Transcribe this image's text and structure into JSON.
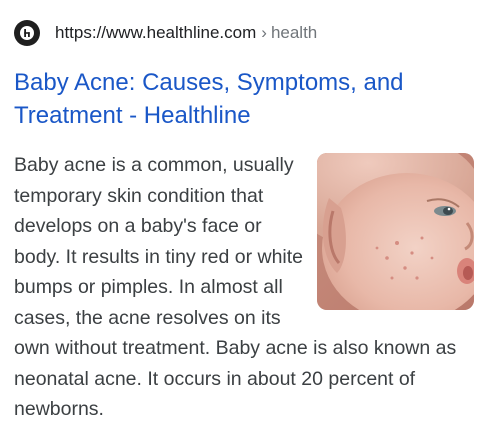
{
  "result": {
    "url": "https://www.healthline.com",
    "breadcrumb_separator": "›",
    "breadcrumb": "health",
    "title": "Baby Acne: Causes, Symptoms, and Treatment - Healthline",
    "snippet": "Baby acne is a common, usually temporary skin condition that develops on a baby's face or body. It results in tiny red or white bumps or pimples. In almost all cases, the acne resolves on its own without treatment. Baby acne is also known as neonatal acne. It occurs in about 20 percent of newborns.",
    "favicon_icon": "healthline-logo-icon",
    "thumbnail_icon": "baby-face-photo",
    "colors": {
      "title_link": "#1a57c7",
      "url_text": "#202124",
      "breadcrumb_text": "#70757a",
      "snippet_text": "#3c4043"
    }
  }
}
